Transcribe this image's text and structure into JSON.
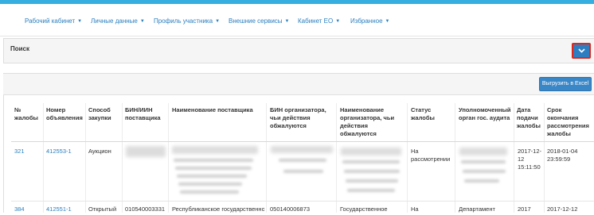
{
  "nav": {
    "items": [
      {
        "label": "Рабочий кабинет"
      },
      {
        "label": "Личные данные"
      },
      {
        "label": "Профиль участника"
      },
      {
        "label": "Внешние сервисы"
      },
      {
        "label": "Кабинет ЕО"
      },
      {
        "label": "Избранное"
      }
    ]
  },
  "search": {
    "title": "Поиск",
    "toggle_icon": "chevron-down-icon"
  },
  "results": {
    "export_label": "Выгрузить в Excel",
    "columns": [
      "№ жалобы",
      "Номер объявления",
      "Способ закупки",
      "БИН/ИИН поставщика",
      "Наименование поставщика",
      "БИН организатора, чьи действия обжалуются",
      "Наименование организатора, чьи действия обжалуются",
      "Статус жалобы",
      "Уполномоченный орган гос. аудита",
      "Дата подачи жалобы",
      "Срок окончания рассмотрения жалобы"
    ],
    "rows": [
      {
        "complaint_no": "321",
        "announcement_no": "412553-1",
        "method": "Аукцион",
        "status": "На рассмотрении",
        "submitted": "2017-12-12 15:11:50",
        "deadline": "2018-01-04 23:59:59"
      },
      {
        "complaint_no": "384",
        "announcement_no": "412551-1",
        "method": "Открытый",
        "supplier_bin": "010540003331",
        "supplier_name": "Республиканское государственное",
        "organizer_bin": "050140006873",
        "organizer_name": "Государственное",
        "status": "На",
        "auditor": "Департамент",
        "submitted": "2017",
        "deadline": "2017-12-12"
      }
    ]
  },
  "colors": {
    "accent": "#36aee0",
    "link": "#2a7fbf",
    "button": "#3a87c8",
    "toggle_border": "#e0251b"
  }
}
